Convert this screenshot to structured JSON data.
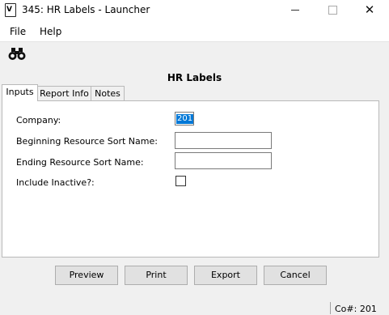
{
  "window": {
    "title": "345: HR Labels - Launcher",
    "app_icon_glyph": "V",
    "minimize_icon": "minimize-icon",
    "maximize_icon": "maximize-icon",
    "close_glyph": "✕"
  },
  "menu": {
    "file": "File",
    "help": "Help"
  },
  "toolbar": {
    "find_icon": "binoculars-icon"
  },
  "form": {
    "title": "HR Labels",
    "tabs": [
      {
        "label": "Inputs",
        "active": true
      },
      {
        "label": "Report Info",
        "active": false
      },
      {
        "label": "Notes",
        "active": false
      }
    ],
    "fields": {
      "company": {
        "label": "Company:",
        "value": "201"
      },
      "begin_sort": {
        "label": "Beginning Resource Sort Name:",
        "value": ""
      },
      "end_sort": {
        "label": "Ending Resource Sort Name:",
        "value": ""
      },
      "include_inactive": {
        "label": "Include Inactive?:",
        "checked": false
      }
    }
  },
  "buttons": {
    "preview": "Preview",
    "print": "Print",
    "export": "Export",
    "cancel": "Cancel"
  },
  "status": {
    "company": "Co#: 201"
  },
  "colors": {
    "selection": "#0078d7",
    "panel_bg": "#ffffff",
    "window_bg": "#f0f0f0"
  }
}
